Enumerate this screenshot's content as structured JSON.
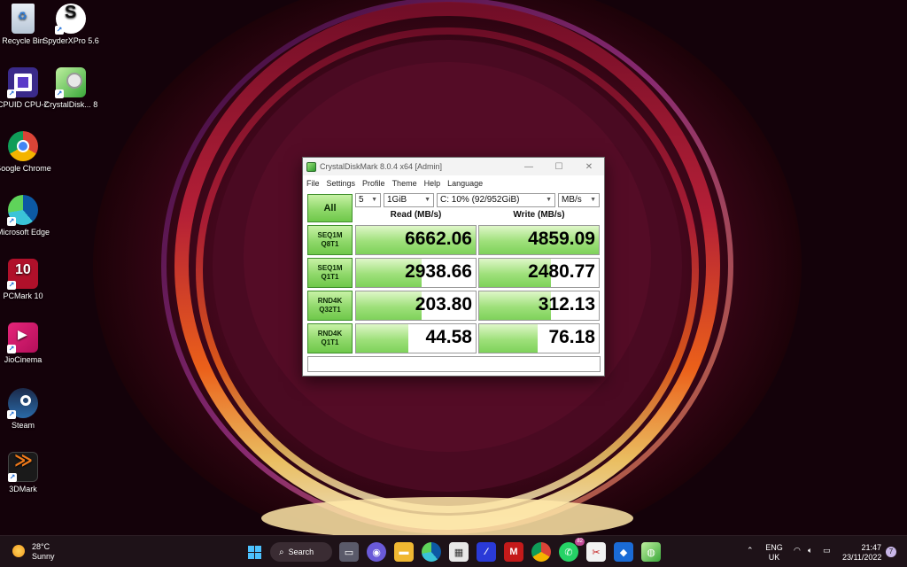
{
  "desktop": {
    "icons": [
      {
        "label": "Recycle Bin"
      },
      {
        "label": "SpyderXPro 5.6"
      },
      {
        "label": "CPUID CPU-Z"
      },
      {
        "label": "CrystalDisk... 8"
      },
      {
        "label": "Google Chrome"
      },
      {
        "label": "Microsoft Edge"
      },
      {
        "label": "PCMark 10"
      },
      {
        "label": "JioCinema"
      },
      {
        "label": "Steam"
      },
      {
        "label": "3DMark"
      }
    ]
  },
  "window": {
    "title": "CrystalDiskMark 8.0.4 x64 [Admin]",
    "menu": [
      "File",
      "Settings",
      "Profile",
      "Theme",
      "Help",
      "Language"
    ],
    "all_button": "All",
    "count_select": "5",
    "size_select": "1GiB",
    "drive_select": "C: 10% (92/952GiB)",
    "unit_select": "MB/s",
    "read_header": "Read (MB/s)",
    "write_header": "Write (MB/s)",
    "rows": [
      {
        "label1": "SEQ1M",
        "label2": "Q8T1",
        "read": "6662.06",
        "write": "4859.09",
        "read_fill": 1.0,
        "write_fill": 1.0
      },
      {
        "label1": "SEQ1M",
        "label2": "Q1T1",
        "read": "2938.66",
        "write": "2480.77",
        "read_fill": 0.55,
        "write_fill": 0.6
      },
      {
        "label1": "RND4K",
        "label2": "Q32T1",
        "read": "203.80",
        "write": "312.13",
        "read_fill": 0.55,
        "write_fill": 0.6
      },
      {
        "label1": "RND4K",
        "label2": "Q1T1",
        "read": "44.58",
        "write": "76.18",
        "read_fill": 0.44,
        "write_fill": 0.49
      }
    ],
    "colors": {
      "accent": "#8fd86a"
    }
  },
  "taskbar": {
    "weather_temp": "28°C",
    "weather_text": "Sunny",
    "search_label": "Search",
    "whatsapp_badge": "82",
    "lang": "ENG",
    "region": "UK",
    "time": "21:47",
    "date": "23/11/2022",
    "notification_count": "7"
  }
}
